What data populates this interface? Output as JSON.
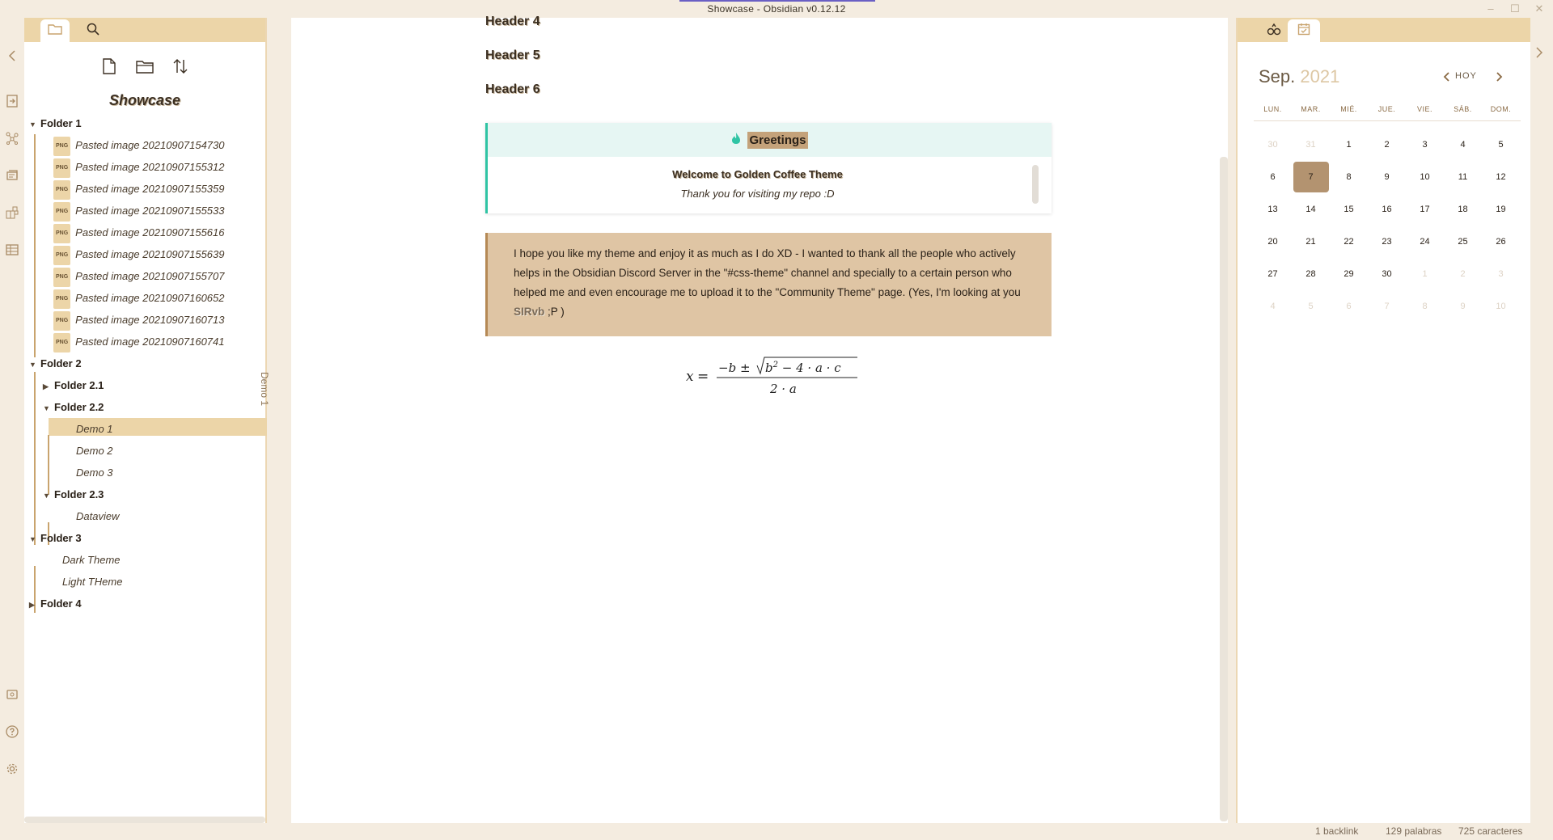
{
  "window": {
    "title": "Showcase - Obsidian v0.12.12",
    "controls": {
      "minimize": "–",
      "maximize": "☐",
      "close": "✕"
    }
  },
  "ribbon": {
    "icons": [
      "chevron-left-icon",
      "open-quick-switcher-icon",
      "graph-view-icon",
      "open-daily-note-icon",
      "kanban-board-icon",
      "table-icon",
      "vault-icon",
      "help-icon",
      "settings-icon"
    ]
  },
  "left_sidebar": {
    "tabs": [
      "file-explorer",
      "search"
    ],
    "actions": [
      "new-note",
      "new-folder",
      "change-sort-order"
    ],
    "vault_name": "Showcase",
    "tree": {
      "folder1": "Folder 1",
      "folder1_files": [
        "Pasted image 20210907154730",
        "Pasted image 20210907155312",
        "Pasted image 20210907155359",
        "Pasted image 20210907155533",
        "Pasted image 20210907155616",
        "Pasted image 20210907155639",
        "Pasted image 20210907155707",
        "Pasted image 20210907160652",
        "Pasted image 20210907160713",
        "Pasted image 20210907160741"
      ],
      "png_badge": "PNG",
      "folder2": "Folder 2",
      "folder2_1": "Folder 2.1",
      "folder2_2": "Folder 2.2",
      "folder2_2_files": [
        "Demo 1",
        "Demo 2",
        "Demo 3"
      ],
      "folder2_3": "Folder 2.3",
      "folder2_3_files": [
        "Dataview"
      ],
      "folder3": "Folder 3",
      "folder3_files": [
        "Dark Theme",
        "Light THeme"
      ],
      "folder4": "Folder 4",
      "selected_file": "Demo 1"
    }
  },
  "collapsed_tab": "Demo 1",
  "editor": {
    "header4": "Header 4",
    "header5": "Header 5",
    "header6": "Header 6",
    "callout": {
      "title": "Greetings",
      "line1": "Welcome to Golden Coffee Theme",
      "line2": "Thank you for visiting my repo :D"
    },
    "quote": {
      "text": "I hope you like my theme and enjoy it as much as I do XD - I wanted to thank all the people who actively helps in the Obsidian Discord Server in the \"#css-theme\" channel and specially to a certain person who helped me and even encourage me to upload it to the \"Community Theme\" page. (Yes, I'm looking at you ",
      "handle": "SIRvb",
      "tail": " ;P )"
    },
    "math": "x = (−b ± √(b² − 4·a·c)) / (2·a)"
  },
  "calendar": {
    "month": "Sep.",
    "year": "2021",
    "today_label": "HOY",
    "weekdays": [
      "LUN.",
      "MAR.",
      "MIÉ.",
      "JUE.",
      "VIE.",
      "SÁB.",
      "DOM."
    ],
    "weeks": [
      [
        {
          "d": "30",
          "m": true
        },
        {
          "d": "31",
          "m": true
        },
        {
          "d": "1"
        },
        {
          "d": "2"
        },
        {
          "d": "3"
        },
        {
          "d": "4"
        },
        {
          "d": "5"
        }
      ],
      [
        {
          "d": "6"
        },
        {
          "d": "7",
          "today": true
        },
        {
          "d": "8"
        },
        {
          "d": "9"
        },
        {
          "d": "10"
        },
        {
          "d": "11"
        },
        {
          "d": "12"
        }
      ],
      [
        {
          "d": "13"
        },
        {
          "d": "14"
        },
        {
          "d": "15"
        },
        {
          "d": "16"
        },
        {
          "d": "17"
        },
        {
          "d": "18"
        },
        {
          "d": "19"
        }
      ],
      [
        {
          "d": "20"
        },
        {
          "d": "21"
        },
        {
          "d": "22"
        },
        {
          "d": "23"
        },
        {
          "d": "24"
        },
        {
          "d": "25"
        },
        {
          "d": "26"
        }
      ],
      [
        {
          "d": "27"
        },
        {
          "d": "28"
        },
        {
          "d": "29"
        },
        {
          "d": "30"
        },
        {
          "d": "1",
          "m": true
        },
        {
          "d": "2",
          "m": true
        },
        {
          "d": "3",
          "m": true
        }
      ],
      [
        {
          "d": "4",
          "m": true
        },
        {
          "d": "5",
          "m": true
        },
        {
          "d": "6",
          "m": true
        },
        {
          "d": "7",
          "m": true
        },
        {
          "d": "8",
          "m": true
        },
        {
          "d": "9",
          "m": true
        },
        {
          "d": "10",
          "m": true
        }
      ]
    ]
  },
  "status_bar": {
    "backlinks": "1 backlink",
    "words": "129 palabras",
    "chars": "725 caracteres"
  },
  "colors": {
    "accent": "#ecd5a8",
    "accent_dark": "#b58955",
    "callout_teal": "#2fc4a4",
    "today": "#b39370"
  }
}
